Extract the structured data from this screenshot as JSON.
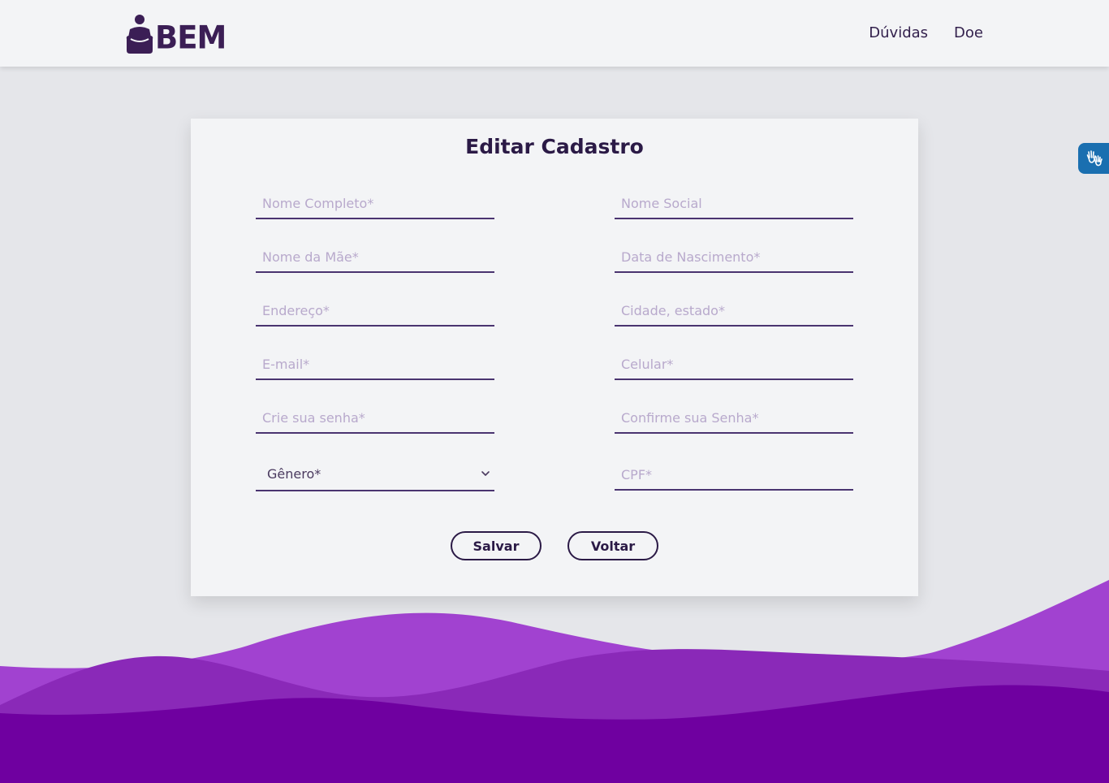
{
  "header": {
    "logo_text": "BEM",
    "nav": [
      {
        "label": "Dúvidas"
      },
      {
        "label": "Doe"
      }
    ]
  },
  "form": {
    "title": "Editar Cadastro",
    "fields": {
      "nome_completo": {
        "placeholder": "Nome Completo*",
        "value": ""
      },
      "nome_social": {
        "placeholder": "Nome Social",
        "value": ""
      },
      "nome_mae": {
        "placeholder": "Nome da Mãe*",
        "value": ""
      },
      "data_nascimento": {
        "placeholder": "Data de Nascimento*",
        "value": ""
      },
      "endereco": {
        "placeholder": "Endereço*",
        "value": ""
      },
      "cidade_estado": {
        "placeholder": "Cidade, estado*",
        "value": ""
      },
      "email": {
        "placeholder": "E-mail*",
        "value": ""
      },
      "celular": {
        "placeholder": "Celular*",
        "value": ""
      },
      "senha": {
        "placeholder": "Crie sua senha*",
        "value": ""
      },
      "confirme_senha": {
        "placeholder": "Confirme sua Senha*",
        "value": ""
      },
      "cpf": {
        "placeholder": "CPF*",
        "value": ""
      }
    },
    "genero": {
      "selected": "Gênero*"
    },
    "buttons": {
      "save": "Salvar",
      "back": "Voltar"
    }
  },
  "colors": {
    "primary_dark": "#2b1a46",
    "wave_light": "#a142d0",
    "wave_mid": "#8a29b8",
    "wave_dark": "#6f00a0",
    "accessibility_blue": "#1a6fb0"
  },
  "icons": {
    "logo": "person-hands-logo-icon",
    "select": "chevron-down-icon",
    "accessibility": "sign-language-hands-icon"
  }
}
